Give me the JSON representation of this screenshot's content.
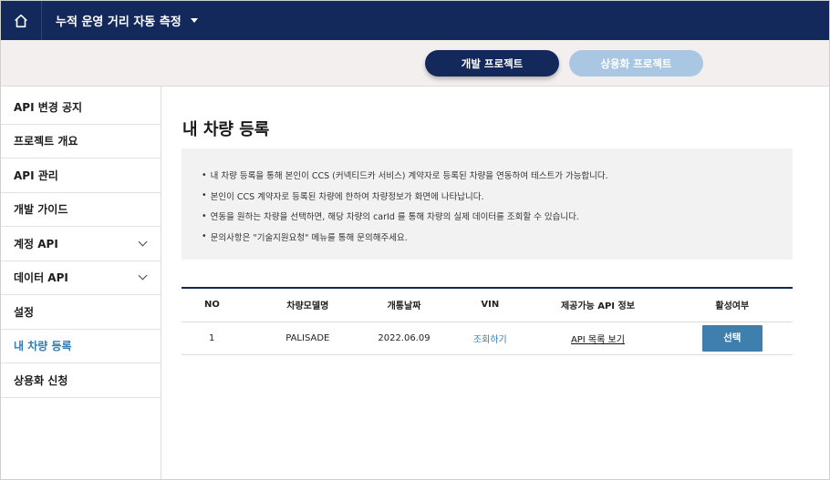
{
  "header": {
    "home_icon": "home-icon",
    "project_name": "누적 운영 거리 자동 측정",
    "caret_icon": "caret-down-icon"
  },
  "project_tabs": {
    "dev_label": "개발 프로젝트",
    "commercial_label": "상용화 프로젝트"
  },
  "sidebar": {
    "items": [
      {
        "label": "API 변경 공지",
        "expandable": false,
        "active": false
      },
      {
        "label": "프로젝트 개요",
        "expandable": false,
        "active": false
      },
      {
        "label": "API 관리",
        "expandable": false,
        "active": false
      },
      {
        "label": "개발 가이드",
        "expandable": false,
        "active": false
      },
      {
        "label": "계정 API",
        "expandable": true,
        "active": false
      },
      {
        "label": "데이터 API",
        "expandable": true,
        "active": false
      },
      {
        "label": "설정",
        "expandable": false,
        "active": false
      },
      {
        "label": "내 차량 등록",
        "expandable": false,
        "active": true
      },
      {
        "label": "상용화 신청",
        "expandable": false,
        "active": false
      }
    ]
  },
  "main": {
    "title": "내 차량 등록",
    "notices": [
      "내 차량 등록을 통해 본인이 CCS (커넥티드카 서비스) 계약자로 등록된 차량을 연동하여 테스트가 가능합니다.",
      "본인이 CCS 계약자로 등록된 차량에 한하여 차량정보가 화면에 나타납니다.",
      "연동을 원하는 차량을 선택하면, 해당 차량의 carId 를 통해 차량의 실제 데이터를 조회할 수 있습니다.",
      "문의사항은 \"기술지원요청\" 메뉴를 통해 문의해주세요."
    ]
  },
  "table": {
    "headers": [
      "NO",
      "차량모델명",
      "개통날짜",
      "VIN",
      "제공가능 API 정보",
      "활성여부"
    ],
    "rows": [
      {
        "no": "1",
        "model": "PALISADE",
        "date": "2022.06.09",
        "vin_link": "조회하기",
        "api_link": "API 목록 보기",
        "action": "선택"
      }
    ]
  },
  "colors": {
    "navy": "#13295b",
    "accent_blue": "#2f7db5",
    "button_blue": "#3f7fae",
    "inactive_pill": "#a9c7e3"
  }
}
